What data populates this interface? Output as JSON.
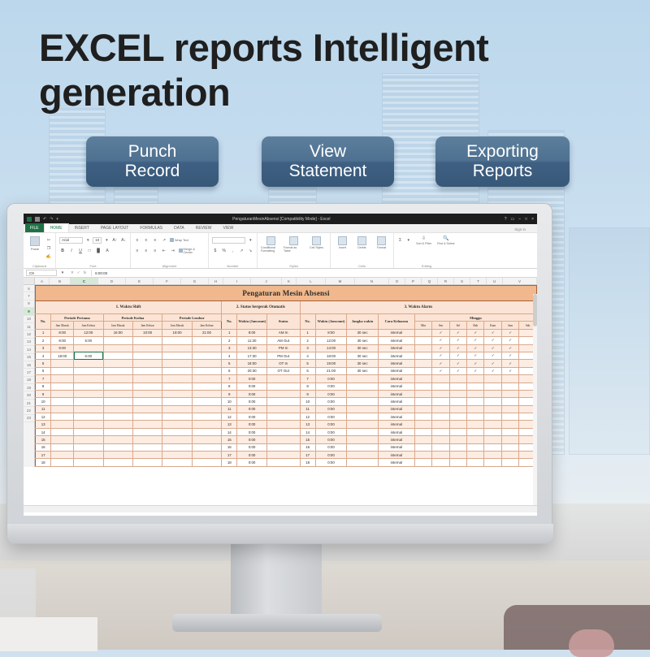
{
  "hero": {
    "headline": "EXCEL reports Intelligent generation",
    "badges": [
      {
        "line1": "Punch",
        "line2": "Record"
      },
      {
        "line1": "View",
        "line2": "Statement"
      },
      {
        "line1": "Exporting",
        "line2": "Reports"
      }
    ],
    "accent_color": "#4a6b8a",
    "sky_color": "#c3dbee"
  },
  "excel": {
    "window_title": "PengaturanMesinAbsensi  [Compatibility Mode]  -  Excel",
    "window_buttons": [
      "?",
      "▭",
      "–",
      "□",
      "×"
    ],
    "sign_in": "Sign in",
    "quick_access": [
      "save-icon",
      "undo-icon",
      "redo-icon",
      "customize-icon"
    ],
    "tabs": [
      {
        "label": "FILE",
        "type": "file"
      },
      {
        "label": "HOME",
        "active": true
      },
      {
        "label": "INSERT",
        "active": false
      },
      {
        "label": "PAGE LAYOUT",
        "active": false
      },
      {
        "label": "FORMULAS",
        "active": false
      },
      {
        "label": "DATA",
        "active": false
      },
      {
        "label": "REVIEW",
        "active": false
      },
      {
        "label": "VIEW",
        "active": false
      }
    ],
    "ribbon": {
      "groups": [
        {
          "name": "Clipboard",
          "paste": "Paste"
        },
        {
          "name": "Font",
          "font_name": "Arial",
          "font_size": "10",
          "buttons": [
            "B",
            "I",
            "U"
          ]
        },
        {
          "name": "Alignment",
          "wrap_text": "Wrap Text",
          "merge": "Merge & Center"
        },
        {
          "name": "Number"
        },
        {
          "name": "Styles",
          "items": [
            "Conditional Formatting",
            "Format as Table",
            "Cell Styles"
          ]
        },
        {
          "name": "Cells",
          "items": [
            "Insert",
            "Delete",
            "Format"
          ]
        },
        {
          "name": "Editing",
          "items": [
            "Sort & Filter",
            "Find & Select"
          ]
        }
      ]
    },
    "name_box": "C9",
    "formula_bar": "6:00:00",
    "columns": [
      "A",
      "B",
      "C",
      "D",
      "E",
      "F",
      "G",
      "H",
      "I",
      "J",
      "K",
      "L",
      "M",
      "N",
      "O",
      "P",
      "Q",
      "R",
      "S",
      "T",
      "U",
      "V"
    ],
    "selected_column": "C",
    "row_numbers": [
      "6",
      "7",
      "8",
      "9",
      "10",
      "11",
      "12",
      "13",
      "14",
      "15",
      "16",
      "17",
      "18",
      "19",
      "20",
      "21",
      "22",
      "23"
    ],
    "selected_row": "9"
  },
  "sheet": {
    "title": "Pengaturan Mesin Absensi",
    "sections": [
      {
        "label": "1. Waktu Shift"
      },
      {
        "label": "2. Status bergerak Otomatis"
      },
      {
        "label": "3. Waktu Alarm"
      }
    ],
    "shift": {
      "no_header": "No.",
      "period_headers": [
        "Periode Pertama",
        "Periode Kedua",
        "Periode Lembur"
      ],
      "sub_headers": [
        "Jam Masuk",
        "Jam Keluar"
      ],
      "rows": [
        {
          "no": "1",
          "p1_in": "8:00",
          "p1_out": "12:00",
          "p2_in": "16:00",
          "p2_out": "10:00",
          "p3_in": "19:00",
          "p3_out": "21:00"
        },
        {
          "no": "2",
          "p1_in": "8:00",
          "p1_out": "5:00",
          "p2_in": "",
          "p2_out": "",
          "p3_in": "",
          "p3_out": ""
        },
        {
          "no": "3",
          "p1_in": "9:00",
          "p1_out": "",
          "p2_in": "",
          "p2_out": "",
          "p3_in": "",
          "p3_out": ""
        },
        {
          "no": "4",
          "p1_in": "18:00",
          "p1_out": "6:00",
          "p2_in": "",
          "p2_out": "",
          "p3_in": "",
          "p3_out": "",
          "selected": "p1_out"
        },
        {
          "no": "5",
          "p1_in": "",
          "p1_out": "",
          "p2_in": "",
          "p2_out": "",
          "p3_in": "",
          "p3_out": ""
        },
        {
          "no": "6",
          "p1_in": "",
          "p1_out": "",
          "p2_in": "",
          "p2_out": "",
          "p3_in": "",
          "p3_out": ""
        },
        {
          "no": "7",
          "p1_in": "",
          "p1_out": "",
          "p2_in": "",
          "p2_out": "",
          "p3_in": "",
          "p3_out": ""
        },
        {
          "no": "8",
          "p1_in": "",
          "p1_out": "",
          "p2_in": "",
          "p2_out": "",
          "p3_in": "",
          "p3_out": ""
        },
        {
          "no": "9",
          "p1_in": "",
          "p1_out": "",
          "p2_in": "",
          "p2_out": "",
          "p3_in": "",
          "p3_out": ""
        },
        {
          "no": "10",
          "p1_in": "",
          "p1_out": "",
          "p2_in": "",
          "p2_out": "",
          "p3_in": "",
          "p3_out": ""
        },
        {
          "no": "11",
          "p1_in": "",
          "p1_out": "",
          "p2_in": "",
          "p2_out": "",
          "p3_in": "",
          "p3_out": ""
        },
        {
          "no": "12",
          "p1_in": "",
          "p1_out": "",
          "p2_in": "",
          "p2_out": "",
          "p3_in": "",
          "p3_out": ""
        },
        {
          "no": "13",
          "p1_in": "",
          "p1_out": "",
          "p2_in": "",
          "p2_out": "",
          "p3_in": "",
          "p3_out": ""
        },
        {
          "no": "14",
          "p1_in": "",
          "p1_out": "",
          "p2_in": "",
          "p2_out": "",
          "p3_in": "",
          "p3_out": ""
        },
        {
          "no": "15",
          "p1_in": "",
          "p1_out": "",
          "p2_in": "",
          "p2_out": "",
          "p3_in": "",
          "p3_out": ""
        },
        {
          "no": "16",
          "p1_in": "",
          "p1_out": "",
          "p2_in": "",
          "p2_out": "",
          "p3_in": "",
          "p3_out": ""
        },
        {
          "no": "17",
          "p1_in": "",
          "p1_out": "",
          "p2_in": "",
          "p2_out": "",
          "p3_in": "",
          "p3_out": ""
        },
        {
          "no": "18",
          "p1_in": "",
          "p1_out": "",
          "p2_in": "",
          "p2_out": "",
          "p3_in": "",
          "p3_out": ""
        }
      ]
    },
    "status": {
      "headers": [
        "No.",
        "Waktu (Jam:mnt)",
        "Status"
      ],
      "rows": [
        {
          "no": "1",
          "waktu": "8:00",
          "status": "AM In"
        },
        {
          "no": "2",
          "waktu": "11:30",
          "status": "AM Out"
        },
        {
          "no": "3",
          "waktu": "13:30",
          "status": "PM In"
        },
        {
          "no": "4",
          "waktu": "17:30",
          "status": "PM Out"
        },
        {
          "no": "5",
          "waktu": "18:00",
          "status": "OT In"
        },
        {
          "no": "6",
          "waktu": "20:30",
          "status": "OT Out"
        },
        {
          "no": "7",
          "waktu": "0:00",
          "status": ""
        },
        {
          "no": "8",
          "waktu": "0:00",
          "status": ""
        },
        {
          "no": "9",
          "waktu": "0:00",
          "status": ""
        },
        {
          "no": "10",
          "waktu": "0:00",
          "status": ""
        },
        {
          "no": "11",
          "waktu": "0:00",
          "status": ""
        },
        {
          "no": "12",
          "waktu": "0:00",
          "status": ""
        },
        {
          "no": "13",
          "waktu": "0:00",
          "status": ""
        },
        {
          "no": "14",
          "waktu": "0:00",
          "status": ""
        },
        {
          "no": "15",
          "waktu": "0:00",
          "status": ""
        },
        {
          "no": "16",
          "waktu": "0:00",
          "status": ""
        },
        {
          "no": "17",
          "waktu": "0:00",
          "status": ""
        },
        {
          "no": "18",
          "waktu": "0:00",
          "status": ""
        }
      ]
    },
    "alarm": {
      "headers": [
        "No.",
        "Waktu (Jam:mnt)",
        "Jangka waktu",
        "Cara Keluaran"
      ],
      "week_header": "Minggu",
      "days": [
        "Min",
        "Sen",
        "Sel",
        "Rab",
        "Kam",
        "Jum",
        "Sab"
      ],
      "rows": [
        {
          "no": "1",
          "waktu": "8:00",
          "jangka": "30 sec",
          "cara": "internal",
          "days": [
            false,
            true,
            true,
            true,
            true,
            true,
            false
          ]
        },
        {
          "no": "2",
          "waktu": "12:00",
          "jangka": "30 sec",
          "cara": "internal",
          "days": [
            false,
            true,
            true,
            true,
            true,
            true,
            false
          ]
        },
        {
          "no": "3",
          "waktu": "14:00",
          "jangka": "30 sec",
          "cara": "internal",
          "days": [
            false,
            true,
            true,
            true,
            true,
            true,
            false
          ]
        },
        {
          "no": "4",
          "waktu": "18:00",
          "jangka": "30 sec",
          "cara": "internal",
          "days": [
            false,
            true,
            true,
            true,
            true,
            true,
            false
          ]
        },
        {
          "no": "5",
          "waktu": "19:00",
          "jangka": "30 sec",
          "cara": "internal",
          "days": [
            false,
            true,
            true,
            true,
            true,
            true,
            false
          ]
        },
        {
          "no": "6",
          "waktu": "21:00",
          "jangka": "30 sec",
          "cara": "internal",
          "days": [
            false,
            true,
            true,
            true,
            true,
            true,
            false
          ]
        },
        {
          "no": "7",
          "waktu": "0:00",
          "jangka": "",
          "cara": "internal",
          "days": [
            false,
            false,
            false,
            false,
            false,
            false,
            false
          ]
        },
        {
          "no": "8",
          "waktu": "0:00",
          "jangka": "",
          "cara": "internal",
          "days": [
            false,
            false,
            false,
            false,
            false,
            false,
            false
          ]
        },
        {
          "no": "9",
          "waktu": "0:00",
          "jangka": "",
          "cara": "internal",
          "days": [
            false,
            false,
            false,
            false,
            false,
            false,
            false
          ]
        },
        {
          "no": "10",
          "waktu": "0:00",
          "jangka": "",
          "cara": "internal",
          "days": [
            false,
            false,
            false,
            false,
            false,
            false,
            false
          ]
        },
        {
          "no": "11",
          "waktu": "0:00",
          "jangka": "",
          "cara": "internal",
          "days": [
            false,
            false,
            false,
            false,
            false,
            false,
            false
          ]
        },
        {
          "no": "12",
          "waktu": "0:00",
          "jangka": "",
          "cara": "internal",
          "days": [
            false,
            false,
            false,
            false,
            false,
            false,
            false
          ]
        },
        {
          "no": "13",
          "waktu": "0:00",
          "jangka": "",
          "cara": "internal",
          "days": [
            false,
            false,
            false,
            false,
            false,
            false,
            false
          ]
        },
        {
          "no": "14",
          "waktu": "0:00",
          "jangka": "",
          "cara": "internal",
          "days": [
            false,
            false,
            false,
            false,
            false,
            false,
            false
          ]
        },
        {
          "no": "15",
          "waktu": "0:00",
          "jangka": "",
          "cara": "internal",
          "days": [
            false,
            false,
            false,
            false,
            false,
            false,
            false
          ]
        },
        {
          "no": "16",
          "waktu": "0:00",
          "jangka": "",
          "cara": "internal",
          "days": [
            false,
            false,
            false,
            false,
            false,
            false,
            false
          ]
        },
        {
          "no": "17",
          "waktu": "0:00",
          "jangka": "",
          "cara": "internal",
          "days": [
            false,
            false,
            false,
            false,
            false,
            false,
            false
          ]
        },
        {
          "no": "18",
          "waktu": "0:00",
          "jangka": "",
          "cara": "internal",
          "days": [
            false,
            false,
            false,
            false,
            false,
            false,
            false
          ]
        }
      ]
    },
    "check_glyph": "✓",
    "header_fill": "#fbe4d5",
    "title_fill": "#f0b88c",
    "border_color": "#a8603c"
  }
}
